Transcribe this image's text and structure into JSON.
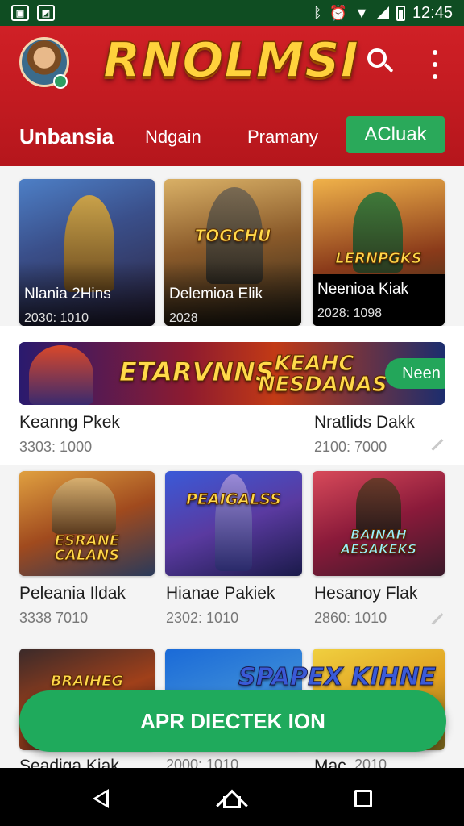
{
  "status_bar": {
    "time": "12:45",
    "icons": [
      "gallery-icon",
      "photo-icon",
      "bluetooth-icon",
      "alarm-icon",
      "wifi-icon",
      "signal-icon",
      "battery-icon"
    ]
  },
  "header": {
    "logo_text": "RNOLMSI",
    "colors": {
      "background": "#c91b21",
      "accent": "#2aa95a",
      "logo": "#ffd23c"
    },
    "tabs": [
      {
        "label": "Unbansia"
      },
      {
        "label": "Ndgain"
      },
      {
        "label": "Pramany"
      },
      {
        "label": "ACluak"
      }
    ]
  },
  "top_cards": [
    {
      "title": "Nlania 2Hins",
      "subtitle": "2030: 1010",
      "art_text": ""
    },
    {
      "title": "Delemioa Elik",
      "subtitle": "2028",
      "art_text": "TOGCHU"
    },
    {
      "title": "Neenioa Kiak",
      "subtitle": "2028: 1098",
      "art_text": "LERNPGKS"
    }
  ],
  "banner": {
    "title_left": "ETARVNNS",
    "title_right": "KEAHC NESDANAS",
    "button_label": "Neen",
    "caption_left": "Keanng Pkek",
    "sub_left": "3303: 1000",
    "caption_right": "Nratlids Dakk",
    "sub_right": "2100: 7000"
  },
  "grid_cards": [
    {
      "title": "Peleania Ildak",
      "subtitle": "3338 7010",
      "art_text": "ESRANE CALANS"
    },
    {
      "title": "Hianae Pakiek",
      "subtitle": "2302: 1010",
      "art_text": "PEAIGALSS"
    },
    {
      "title": "Hesanoy Flak",
      "subtitle": "2860: 1010",
      "art_text": "BAINAH AESAKEKS"
    }
  ],
  "bottom_cards": [
    {
      "title": "Seadiga Kiak",
      "subtitle": "",
      "art_text": "BRAIHEG"
    },
    {
      "title": "",
      "subtitle": "2000: 1010",
      "art_text": "SPAPEX KIHNE"
    },
    {
      "title": "Mac",
      "subtitle": "2010",
      "art_text": ""
    }
  ],
  "cta_label": "APR DIECTEK ION"
}
